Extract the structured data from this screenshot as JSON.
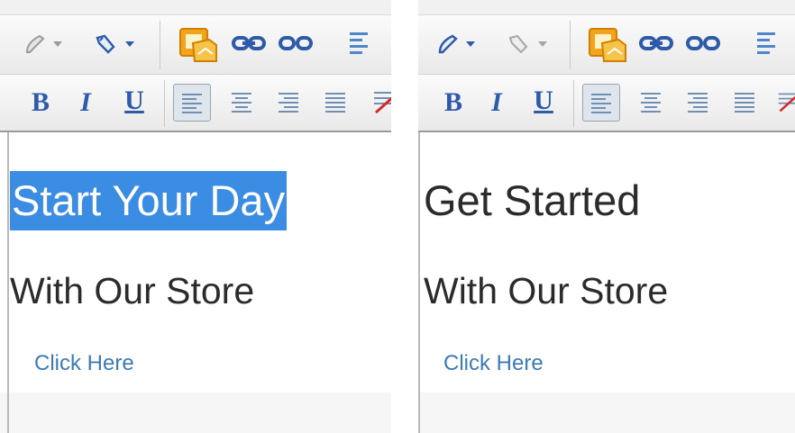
{
  "panels": [
    {
      "toolbar": {
        "bold_label": "B",
        "italic_label": "I",
        "underline_label": "U"
      },
      "content": {
        "heading": "Start Your Day",
        "heading_selected": true,
        "subheading": "With Our Store",
        "link": "Click Here"
      }
    },
    {
      "toolbar": {
        "bold_label": "B",
        "italic_label": "I",
        "underline_label": "U"
      },
      "content": {
        "heading": "Get Started",
        "heading_selected": false,
        "subheading": "With Our Store",
        "link": "Click Here"
      }
    }
  ],
  "icons": [
    "brush-icon",
    "dropdown-arrow-icon",
    "eraser-icon",
    "insert-image-icon",
    "link-icon",
    "unlink-icon",
    "align-left-icon",
    "align-center-icon",
    "align-right-icon",
    "align-justify-icon",
    "clear-format-icon"
  ],
  "colors": {
    "selection": "#3b8de3",
    "link": "#3d7ab8",
    "format_buttons": "#2d5aa9",
    "image_icon": "#f2a51c"
  }
}
